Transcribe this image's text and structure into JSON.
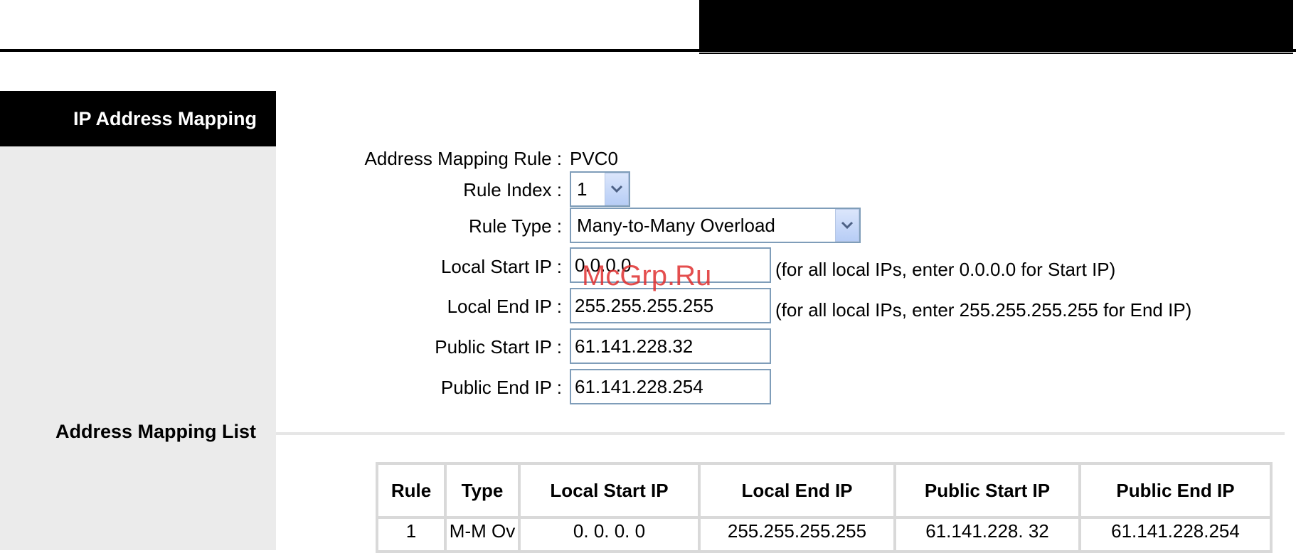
{
  "section": {
    "title": "IP Address Mapping"
  },
  "form": {
    "mapping_rule": {
      "label": "Address Mapping Rule :",
      "value": "PVC0"
    },
    "rule_index": {
      "label": "Rule Index :",
      "value": "1"
    },
    "rule_type": {
      "label": "Rule Type :",
      "value": "Many-to-Many Overload"
    },
    "local_start_ip": {
      "label": "Local Start IP :",
      "value": "0.0.0.0",
      "hint": "(for all local IPs, enter 0.0.0.0 for Start IP)"
    },
    "local_end_ip": {
      "label": "Local End IP :",
      "value": "255.255.255.255",
      "hint": "(for all local IPs, enter 255.255.255.255 for End IP)"
    },
    "public_start_ip": {
      "label": "Public Start IP :",
      "value": "61.141.228.32"
    },
    "public_end_ip": {
      "label": "Public End IP :",
      "value": "61.141.228.254"
    }
  },
  "list": {
    "title": "Address Mapping List",
    "columns": [
      "Rule",
      "Type",
      "Local Start IP",
      "Local End IP",
      "Public Start IP",
      "Public End IP"
    ],
    "rows": [
      [
        "1",
        "M-M Ov",
        "0. 0. 0. 0",
        "255.255.255.255",
        "61.141.228. 32",
        "61.141.228.254"
      ]
    ]
  },
  "watermark": "McGrp.Ru",
  "colors": {
    "header_bg": "#000000",
    "sidebar_bg": "#ebebeb",
    "input_border": "#7f9db9",
    "watermark": "#e03030"
  }
}
